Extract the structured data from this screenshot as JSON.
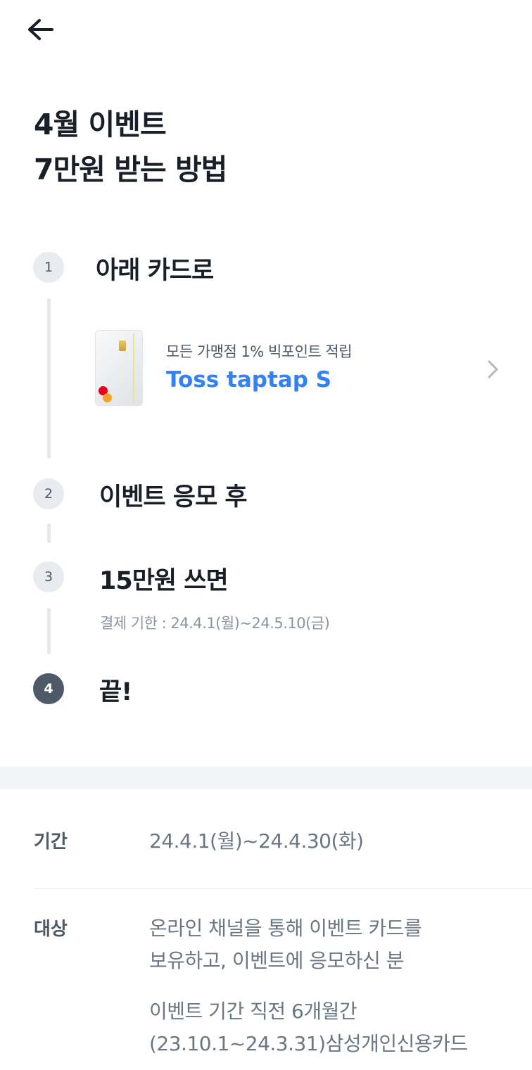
{
  "header": {
    "back_icon": "arrow-left-icon"
  },
  "title": {
    "line1": "4월 이벤트",
    "line2": "7만원 받는 방법"
  },
  "steps": [
    {
      "number": "1",
      "title": "아래 카드로"
    },
    {
      "number": "2",
      "title": "이벤트 응모 후"
    },
    {
      "number": "3",
      "title": "15만원 쓰면",
      "note": "결제 기한 : 24.4.1(월)~24.5.10(금)"
    },
    {
      "number": "4",
      "title": "끝!"
    }
  ],
  "card": {
    "subtitle": "모든 가맹점 1% 빅포인트 적립",
    "name": "Toss taptap S",
    "accent": "#3182f6",
    "chevron_icon": "chevron-right-icon"
  },
  "info": {
    "period_label": "기간",
    "period_value": "24.4.1(월)~24.4.30(화)",
    "target_label": "대상",
    "target_lines": [
      "온라인 채널을 통해 이벤트 카드를",
      "보유하고, 이벤트에 응모하신 분",
      "이벤트 기간 직전 6개월간",
      "(23.10.1~24.3.31)삼성개인신용카드"
    ]
  }
}
